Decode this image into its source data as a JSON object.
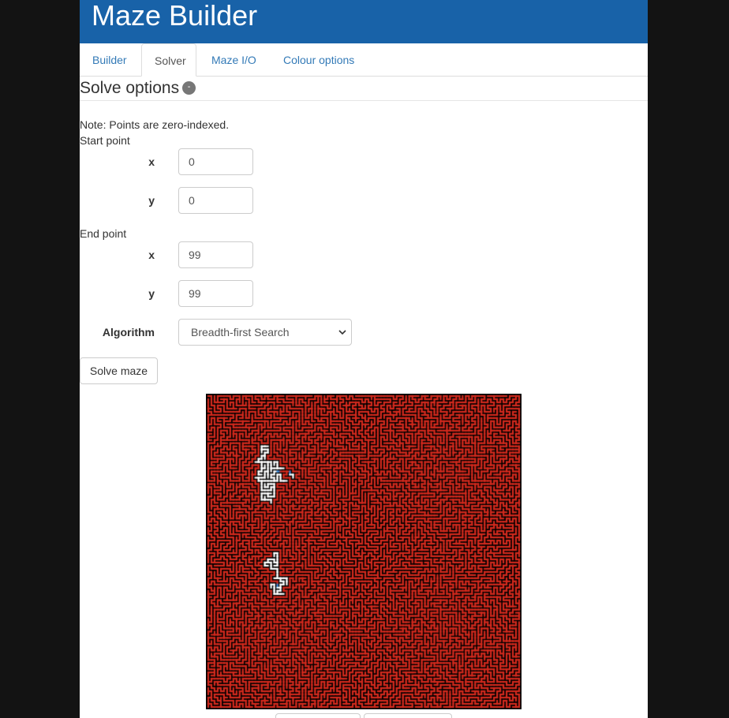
{
  "header": {
    "title": "Maze Builder"
  },
  "tabs": [
    {
      "label": "Builder"
    },
    {
      "label": "Solver"
    },
    {
      "label": "Maze I/O"
    },
    {
      "label": "Colour options"
    }
  ],
  "solve": {
    "title": "Solve options",
    "toggle": "-",
    "note": "Note: Points are zero-indexed.",
    "start_label": "Start point",
    "end_label": "End point",
    "x_label": "x",
    "y_label": "y",
    "start_x": "0",
    "start_y": "0",
    "end_x": "99",
    "end_y": "99",
    "algorithm_label": "Algorithm",
    "algorithm_value": "Breadth-first Search",
    "solve_button": "Solve maze"
  },
  "maze": {
    "grid_size": 100,
    "colors": {
      "wall": "#000000",
      "visited": "#d42a1e",
      "frontier": "#2f8ae0",
      "unvisited": "#ffffff"
    }
  }
}
